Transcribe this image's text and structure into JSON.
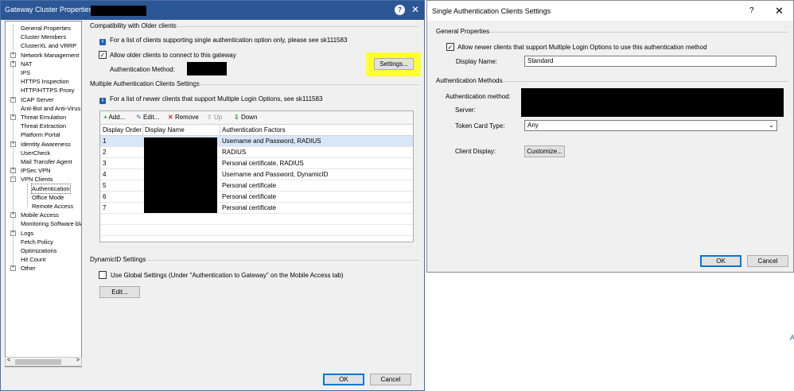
{
  "gateway_window": {
    "title": "Gateway Cluster Properties -",
    "help_glyph": "?",
    "close_glyph": "✕",
    "tree": {
      "items": [
        {
          "label": "General Properties",
          "expander": ""
        },
        {
          "label": "Cluster Members",
          "expander": ""
        },
        {
          "label": "ClusterXL and VRRP",
          "expander": ""
        },
        {
          "label": "Network Management",
          "expander": "+"
        },
        {
          "label": "NAT",
          "expander": "+"
        },
        {
          "label": "IPS",
          "expander": ""
        },
        {
          "label": "HTTPS Inspection",
          "expander": ""
        },
        {
          "label": "HTTP/HTTPS Proxy",
          "expander": ""
        },
        {
          "label": "ICAP Server",
          "expander": "+"
        },
        {
          "label": "Anti-Bot and Anti-Virus",
          "expander": ""
        },
        {
          "label": "Threat Emulation",
          "expander": "+"
        },
        {
          "label": "Threat Extraction",
          "expander": ""
        },
        {
          "label": "Platform Portal",
          "expander": ""
        },
        {
          "label": "Identity Awareness",
          "expander": "+"
        },
        {
          "label": "UserCheck",
          "expander": ""
        },
        {
          "label": "Mail Transfer Agent",
          "expander": ""
        },
        {
          "label": "IPSec VPN",
          "expander": "+"
        },
        {
          "label": "VPN Clients",
          "expander": "−"
        },
        {
          "label": "Authentication",
          "expander": "",
          "child": true,
          "selected": true
        },
        {
          "label": "Office Mode",
          "expander": "",
          "child": true
        },
        {
          "label": "Remote Access",
          "expander": "",
          "child": true
        },
        {
          "label": "Mobile Access",
          "expander": "+"
        },
        {
          "label": "Monitoring Software bla",
          "expander": ""
        },
        {
          "label": "Logs",
          "expander": "+"
        },
        {
          "label": "Fetch Policy",
          "expander": ""
        },
        {
          "label": "Optimizations",
          "expander": ""
        },
        {
          "label": "Hit Count",
          "expander": ""
        },
        {
          "label": "Other",
          "expander": "+"
        }
      ],
      "scroll_left": "<",
      "scroll_right": ">"
    },
    "compat": {
      "heading": "Compatibility with Older clients",
      "info": "For a list of clients supporting single authentication option only, please see sk111583",
      "allow_label": "Allow older clients to connect to this gateway",
      "allow_checked": "✓",
      "auth_method_label": "Authentication Method:",
      "settings_button": "Settings..."
    },
    "multi": {
      "heading": "Multiple Authentication Clients Settings",
      "info": "For a list of newer clients that support Multiple Login Options, see sk111583",
      "toolbar": {
        "add": "Add...",
        "edit": "Edit...",
        "remove": "Remove",
        "up": "Up",
        "down": "Down"
      },
      "columns": [
        "Display Order",
        "Display Name",
        "Authentication Factors"
      ],
      "rows": [
        {
          "order": "1",
          "factors": "Username and Password, RADIUS"
        },
        {
          "order": "2",
          "factors": "RADIUS"
        },
        {
          "order": "3",
          "factors": "Personal certificate, RADIUS"
        },
        {
          "order": "4",
          "factors": "Username and Password, DynamicID"
        },
        {
          "order": "5",
          "factors": "Personal certificate"
        },
        {
          "order": "6",
          "factors": "Personal certificate"
        },
        {
          "order": "7",
          "factors": "Personal certificate"
        }
      ]
    },
    "dynamicid": {
      "heading": "DynamicID Settings",
      "use_global_label": "Use Global Settings (Under \"Authentication to Gateway\" on the Mobile Access tab)",
      "edit_button": "Edit..."
    },
    "ok_button": "OK",
    "cancel_button": "Cancel"
  },
  "single_auth_window": {
    "title": "Single Authentication Clients Settings",
    "help_glyph": "?",
    "close_glyph": "✕",
    "general": {
      "heading": "General Properties",
      "allow_label": "Allow newer clients that support Multiple Login Options to use this authentication method",
      "allow_checked": "✓",
      "display_name_label": "Display Name:",
      "display_name_value": "Standard"
    },
    "methods": {
      "heading": "Authentication Methods",
      "auth_method_label": "Authentication method:",
      "server_label": "Server:",
      "token_label": "Token Card Type:",
      "token_value": "Any",
      "token_arrow": "⌄",
      "client_display_label": "Client Display:",
      "customize_button": "Customize..."
    },
    "ok_button": "OK",
    "cancel_button": "Cancel"
  },
  "side_glyph": "A",
  "colors": {
    "titlebar_blue": "#2b5797",
    "highlight_yellow": "#ffff33",
    "selected_row": "#d9e6f5",
    "info_icon_blue": "#1e5fb4"
  }
}
